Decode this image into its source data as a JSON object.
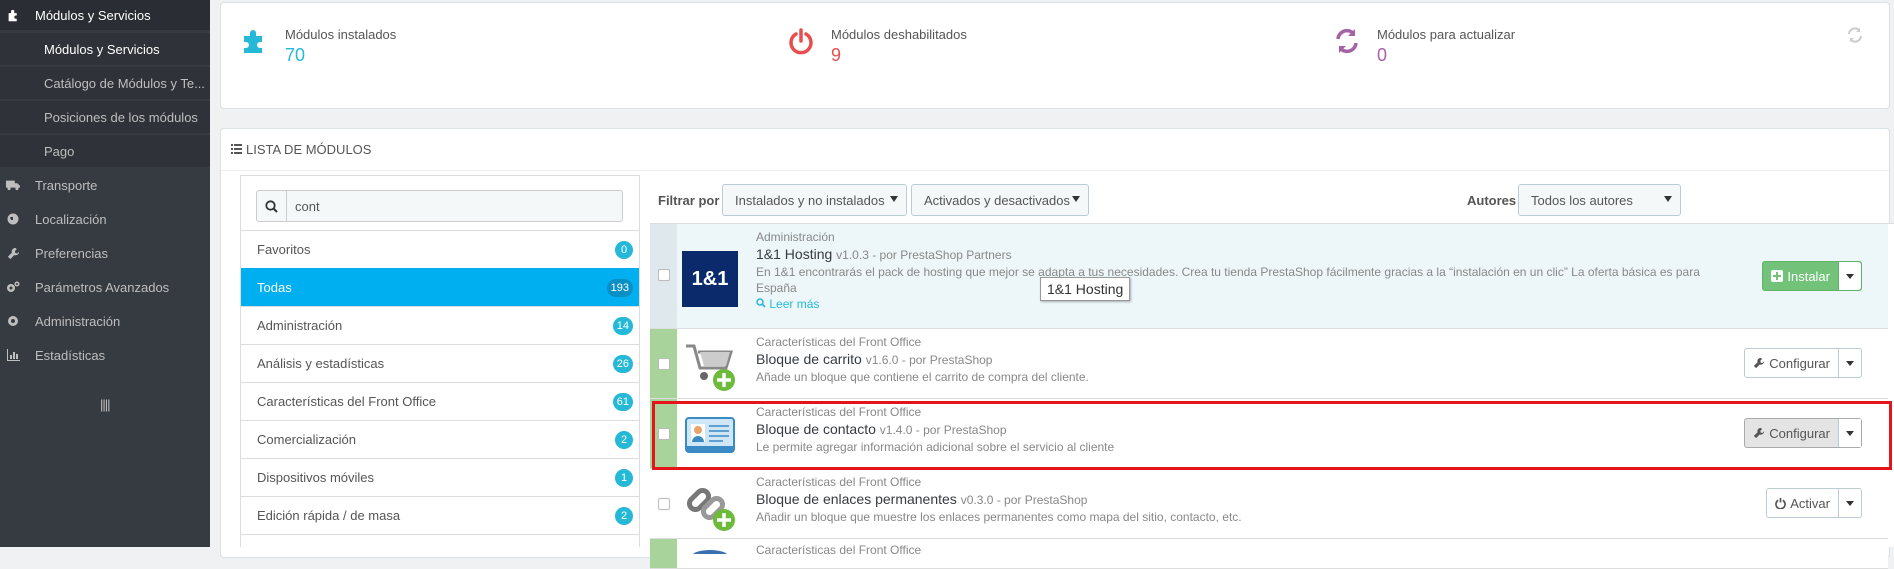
{
  "sidebar": {
    "modules_title": "Módulos y Servicios",
    "sub_items": [
      {
        "label": "Módulos y Servicios"
      },
      {
        "label": "Catálogo de Módulos y Te..."
      },
      {
        "label": "Posiciones de los módulos"
      },
      {
        "label": "Pago"
      }
    ],
    "items": [
      {
        "label": "Transporte",
        "icon": "truck-icon"
      },
      {
        "label": "Localización",
        "icon": "globe-icon"
      },
      {
        "label": "Preferencias",
        "icon": "wrench-icon"
      },
      {
        "label": "Parámetros Avanzados",
        "icon": "cogs-icon"
      },
      {
        "label": "Administración",
        "icon": "gear-icon"
      },
      {
        "label": "Estadísticas",
        "icon": "bar-chart-icon"
      }
    ],
    "collapse_glyph": "||||"
  },
  "kpis": [
    {
      "label": "Módulos instalados",
      "value": "70",
      "color": "#25b9d7"
    },
    {
      "label": "Módulos deshabilitados",
      "value": "9",
      "color": "#e84e4e"
    },
    {
      "label": "Módulos para actualizar",
      "value": "0",
      "color": "#a463a4"
    }
  ],
  "list_panel": {
    "title": "LISTA DE MÓDULOS"
  },
  "search": {
    "value": "cont"
  },
  "categories": [
    {
      "label": "Favoritos",
      "count": "0"
    },
    {
      "label": "Todas",
      "count": "193"
    },
    {
      "label": "Administración",
      "count": "14"
    },
    {
      "label": "Análisis y estadísticas",
      "count": "26"
    },
    {
      "label": "Características del Front Office",
      "count": "61"
    },
    {
      "label": "Comercialización",
      "count": "2"
    },
    {
      "label": "Dispositivos móviles",
      "count": "1"
    },
    {
      "label": "Edición rápida / de masa",
      "count": "2"
    }
  ],
  "filters": {
    "filter_label": "Filtrar por",
    "install_select": "Instalados y no instalados",
    "status_select": "Activados y desactivados",
    "authors_label": "Autores",
    "authors_select": "Todos los autores"
  },
  "modules": [
    {
      "category": "Administración",
      "name": "1&1 Hosting",
      "version": "v1.0.3 - por PrestaShop Partners",
      "description_1": "En 1&1 encontrarás el pack de hosting que mejor se adapta a tus necesidades. Crea tu tienda PrestaShop fácilmente gracias a la “instalación en un clic” La oferta básica es para",
      "description_2": "España",
      "read_more": "Leer más",
      "logo_text": "1&1",
      "action": "Instalar"
    },
    {
      "category": "Características del Front Office",
      "name": "Bloque de carrito",
      "version": "v1.6.0 - por PrestaShop",
      "description": "Añade un bloque que contiene el carrito de compra del cliente.",
      "action": "Configurar"
    },
    {
      "category": "Características del Front Office",
      "name": "Bloque de contacto",
      "version": "v1.4.0 - por PrestaShop",
      "description": "Le permite agregar información adicional sobre el servicio al cliente",
      "action": "Configurar"
    },
    {
      "category": "Características del Front Office",
      "name": "Bloque de enlaces permanentes",
      "version": "v0.3.0 - por PrestaShop",
      "description": "Añadir un bloque que muestre los enlaces permanentes como mapa del sitio, contacto, etc.",
      "action": "Activar"
    },
    {
      "category": "Características del Front Office"
    }
  ],
  "tooltip": "1&1 Hosting"
}
